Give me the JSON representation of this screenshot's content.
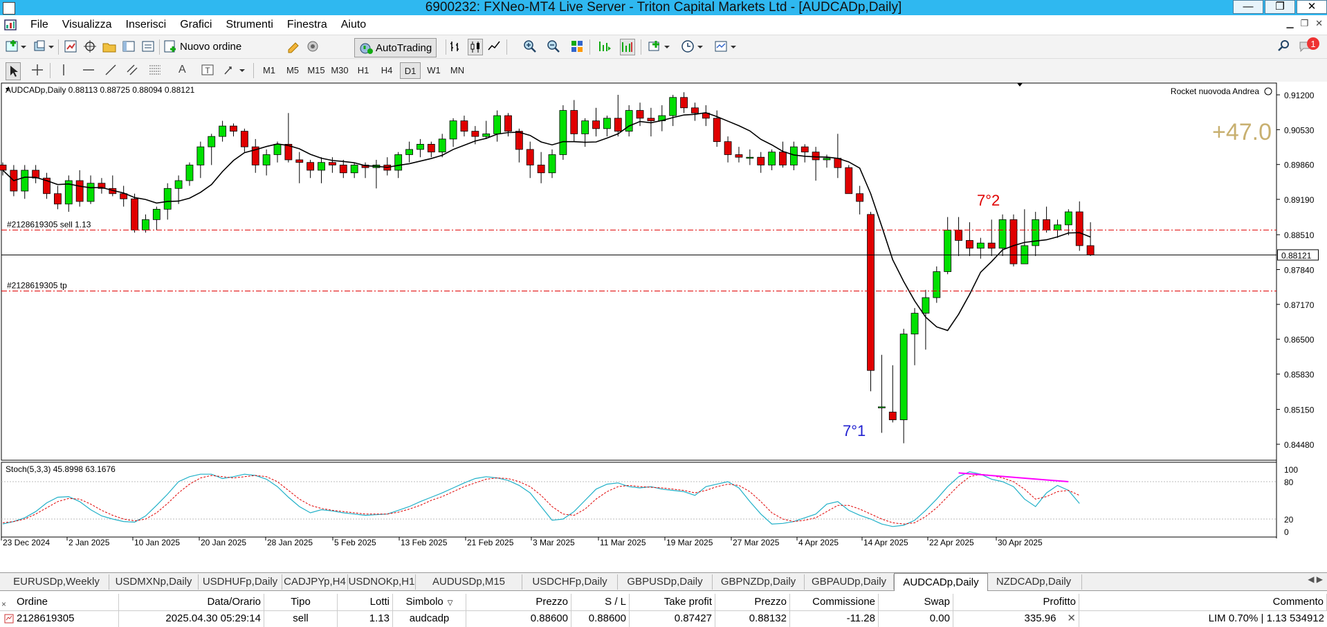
{
  "window": {
    "title": "6900232: FXNeo-MT4 Live Server - Triton Capital Markets Ltd - [AUDCADp,Daily]",
    "minimize": "—",
    "restore": "❐",
    "close": "✕"
  },
  "menu": {
    "items": [
      "File",
      "Visualizza",
      "Inserisci",
      "Grafici",
      "Strumenti",
      "Finestra",
      "Aiuto"
    ]
  },
  "toolbar": {
    "new_order_label": "Nuovo ordine",
    "autotrading_label": "AutoTrading",
    "timeframes": [
      "M1",
      "M5",
      "M15",
      "M30",
      "H1",
      "H4",
      "D1",
      "W1",
      "MN"
    ],
    "active_timeframe": "D1",
    "notification_count": "1"
  },
  "chart": {
    "header": "AUDCADp,Daily  0.88113 0.88725 0.88094 0.88121",
    "indicator_name": "Rocket nuovoda Andrea",
    "big_number": "+47.0",
    "current_price": "0.88121",
    "price_ticks": [
      "0.91200",
      "0.90530",
      "0.89860",
      "0.89190",
      "0.88510",
      "0.87840",
      "0.87170",
      "0.86500",
      "0.85830",
      "0.85150",
      "0.84480"
    ],
    "date_ticks": [
      "23 Dec 2024",
      "2 Jan 2025",
      "10 Jan 2025",
      "20 Jan 2025",
      "28 Jan 2025",
      "5 Feb 2025",
      "13 Feb 2025",
      "21 Feb 2025",
      "3 Mar 2025",
      "11 Mar 2025",
      "19 Mar 2025",
      "27 Mar 2025",
      "4 Apr 2025",
      "14 Apr 2025",
      "22 Apr 2025",
      "30 Apr 2025"
    ],
    "order_sell_label": "#2128619305 sell 1.13",
    "order_tp_label": "#2128619305 tp",
    "wave_label_top": "7°2",
    "wave_label_bottom": "7°1",
    "stoch_header": "Stoch(5,3,3) 45.8998 63.1676",
    "stoch_ticks": [
      "100",
      "80",
      "20",
      "0"
    ],
    "colors": {
      "bull": "#00e000",
      "bear": "#e00000",
      "ma": "#000000",
      "order_line": "#e00000",
      "stoch_main": "#20b0c8",
      "stoch_signal": "#e00000",
      "divergence": "#ff00ff"
    }
  },
  "chart_data": {
    "type": "candlestick",
    "ylim": [
      0.842,
      0.914
    ],
    "sell_price": 0.886,
    "tp_price": 0.87427,
    "candles": [
      [
        0.8985,
        0.899,
        0.8965,
        0.8975
      ],
      [
        0.8975,
        0.8985,
        0.8925,
        0.8935
      ],
      [
        0.8935,
        0.8985,
        0.892,
        0.8975
      ],
      [
        0.8975,
        0.8985,
        0.895,
        0.896
      ],
      [
        0.896,
        0.897,
        0.892,
        0.893
      ],
      [
        0.893,
        0.8945,
        0.89,
        0.891
      ],
      [
        0.891,
        0.8965,
        0.8895,
        0.8955
      ],
      [
        0.8955,
        0.8975,
        0.8905,
        0.8915
      ],
      [
        0.8915,
        0.8965,
        0.891,
        0.895
      ],
      [
        0.895,
        0.896,
        0.893,
        0.894
      ],
      [
        0.894,
        0.8965,
        0.8925,
        0.893
      ],
      [
        0.893,
        0.8945,
        0.8905,
        0.892
      ],
      [
        0.892,
        0.893,
        0.8855,
        0.886
      ],
      [
        0.886,
        0.889,
        0.8855,
        0.888
      ],
      [
        0.888,
        0.8905,
        0.886,
        0.89
      ],
      [
        0.89,
        0.895,
        0.888,
        0.894
      ],
      [
        0.894,
        0.8965,
        0.891,
        0.8955
      ],
      [
        0.8955,
        0.899,
        0.8945,
        0.8985
      ],
      [
        0.8985,
        0.903,
        0.896,
        0.902
      ],
      [
        0.902,
        0.9045,
        0.8985,
        0.904
      ],
      [
        0.904,
        0.907,
        0.903,
        0.906
      ],
      [
        0.906,
        0.9065,
        0.904,
        0.905
      ],
      [
        0.905,
        0.9055,
        0.901,
        0.902
      ],
      [
        0.902,
        0.9035,
        0.897,
        0.8985
      ],
      [
        0.8985,
        0.9015,
        0.8965,
        0.9005
      ],
      [
        0.9005,
        0.903,
        0.899,
        0.9025
      ],
      [
        0.9025,
        0.9085,
        0.899,
        0.8995
      ],
      [
        0.8995,
        0.901,
        0.895,
        0.899
      ],
      [
        0.899,
        0.8995,
        0.896,
        0.8975
      ],
      [
        0.8975,
        0.9,
        0.895,
        0.899
      ],
      [
        0.899,
        0.9,
        0.897,
        0.8985
      ],
      [
        0.8985,
        0.8995,
        0.896,
        0.897
      ],
      [
        0.897,
        0.899,
        0.896,
        0.8985
      ],
      [
        0.8985,
        0.899,
        0.896,
        0.898
      ],
      [
        0.898,
        0.8995,
        0.894,
        0.8985
      ],
      [
        0.8985,
        0.9,
        0.8965,
        0.8975
      ],
      [
        0.8975,
        0.901,
        0.896,
        0.9005
      ],
      [
        0.9005,
        0.903,
        0.899,
        0.9015
      ],
      [
        0.9015,
        0.9035,
        0.9,
        0.9025
      ],
      [
        0.9025,
        0.903,
        0.9,
        0.901
      ],
      [
        0.901,
        0.9045,
        0.9,
        0.9035
      ],
      [
        0.9035,
        0.9075,
        0.902,
        0.907
      ],
      [
        0.907,
        0.908,
        0.904,
        0.905
      ],
      [
        0.905,
        0.906,
        0.9025,
        0.904
      ],
      [
        0.904,
        0.907,
        0.9035,
        0.9045
      ],
      [
        0.9045,
        0.909,
        0.903,
        0.908
      ],
      [
        0.908,
        0.9085,
        0.904,
        0.905
      ],
      [
        0.905,
        0.9055,
        0.899,
        0.9015
      ],
      [
        0.9015,
        0.903,
        0.896,
        0.8985
      ],
      [
        0.8985,
        0.901,
        0.895,
        0.897
      ],
      [
        0.897,
        0.9015,
        0.896,
        0.9005
      ],
      [
        0.9005,
        0.91,
        0.8995,
        0.909
      ],
      [
        0.909,
        0.911,
        0.903,
        0.9045
      ],
      [
        0.9045,
        0.9075,
        0.902,
        0.907
      ],
      [
        0.907,
        0.9095,
        0.904,
        0.9055
      ],
      [
        0.9055,
        0.908,
        0.904,
        0.9075
      ],
      [
        0.9075,
        0.912,
        0.904,
        0.905
      ],
      [
        0.905,
        0.91,
        0.904,
        0.909
      ],
      [
        0.909,
        0.9105,
        0.906,
        0.9075
      ],
      [
        0.9075,
        0.9095,
        0.904,
        0.907
      ],
      [
        0.907,
        0.91,
        0.905,
        0.908
      ],
      [
        0.908,
        0.912,
        0.906,
        0.9115
      ],
      [
        0.9115,
        0.9125,
        0.9085,
        0.9095
      ],
      [
        0.9095,
        0.9105,
        0.907,
        0.9085
      ],
      [
        0.9085,
        0.91,
        0.906,
        0.9075
      ],
      [
        0.9075,
        0.909,
        0.902,
        0.903
      ],
      [
        0.903,
        0.904,
        0.899,
        0.9005
      ],
      [
        0.9005,
        0.902,
        0.899,
        0.9
      ],
      [
        0.9,
        0.9015,
        0.8985,
        0.9
      ],
      [
        0.9,
        0.901,
        0.897,
        0.8985
      ],
      [
        0.8985,
        0.9015,
        0.8975,
        0.901
      ],
      [
        0.901,
        0.903,
        0.898,
        0.8985
      ],
      [
        0.8985,
        0.903,
        0.8975,
        0.902
      ],
      [
        0.902,
        0.9025,
        0.899,
        0.901
      ],
      [
        0.901,
        0.902,
        0.8955,
        0.8995
      ],
      [
        0.8995,
        0.9005,
        0.898,
        0.8998
      ],
      [
        0.8998,
        0.9045,
        0.896,
        0.898
      ],
      [
        0.898,
        0.8985,
        0.895,
        0.893
      ],
      [
        0.893,
        0.8945,
        0.889,
        0.8915
      ],
      [
        0.889,
        0.8895,
        0.855,
        0.859
      ],
      [
        0.852,
        0.862,
        0.847,
        0.852
      ],
      [
        0.851,
        0.86,
        0.849,
        0.8495
      ],
      [
        0.8495,
        0.867,
        0.845,
        0.866
      ],
      [
        0.866,
        0.871,
        0.86,
        0.87
      ],
      [
        0.87,
        0.8745,
        0.863,
        0.873
      ],
      [
        0.873,
        0.879,
        0.872,
        0.878
      ],
      [
        0.878,
        0.8885,
        0.8775,
        0.886
      ],
      [
        0.886,
        0.8885,
        0.881,
        0.884
      ],
      [
        0.884,
        0.8875,
        0.881,
        0.8825
      ],
      [
        0.8825,
        0.8845,
        0.8805,
        0.8835
      ],
      [
        0.8835,
        0.888,
        0.881,
        0.8825
      ],
      [
        0.8825,
        0.889,
        0.881,
        0.888
      ],
      [
        0.888,
        0.889,
        0.879,
        0.8795
      ],
      [
        0.8795,
        0.89,
        0.8795,
        0.883
      ],
      [
        0.883,
        0.8895,
        0.881,
        0.888
      ],
      [
        0.888,
        0.8905,
        0.8855,
        0.886
      ],
      [
        0.886,
        0.888,
        0.8845,
        0.887
      ],
      [
        0.887,
        0.89,
        0.885,
        0.8895
      ],
      [
        0.8895,
        0.8915,
        0.882,
        0.883
      ],
      [
        0.883,
        0.8875,
        0.881,
        0.8812
      ]
    ],
    "stoch_main": [
      12,
      16,
      22,
      32,
      46,
      55,
      56,
      48,
      35,
      25,
      20,
      16,
      15,
      25,
      42,
      60,
      80,
      88,
      92,
      92,
      85,
      88,
      92,
      90,
      84,
      72,
      55,
      40,
      30,
      35,
      33,
      30,
      28,
      26,
      27,
      28,
      34,
      40,
      48,
      55,
      62,
      70,
      78,
      85,
      88,
      86,
      82,
      74,
      62,
      40,
      18,
      20,
      32,
      50,
      68,
      76,
      78,
      72,
      70,
      72,
      68,
      66,
      64,
      58,
      72,
      76,
      80,
      70,
      48,
      28,
      12,
      13,
      16,
      22,
      28,
      44,
      48,
      34,
      26,
      20,
      12,
      8,
      10,
      18,
      34,
      52,
      72,
      88,
      96,
      92,
      84,
      80,
      72,
      52,
      40,
      62,
      74,
      66,
      45
    ],
    "stoch_signal": [
      14,
      16,
      20,
      28,
      38,
      48,
      53,
      52,
      44,
      34,
      26,
      20,
      17,
      20,
      30,
      45,
      62,
      76,
      86,
      90,
      88,
      86,
      88,
      90,
      88,
      80,
      66,
      52,
      42,
      37,
      34,
      32,
      30,
      28,
      28,
      28,
      31,
      36,
      42,
      50,
      56,
      64,
      72,
      78,
      84,
      86,
      85,
      80,
      72,
      58,
      40,
      28,
      26,
      36,
      52,
      64,
      72,
      74,
      72,
      71,
      70,
      68,
      66,
      62,
      66,
      72,
      76,
      74,
      64,
      48,
      30,
      20,
      16,
      18,
      22,
      32,
      42,
      42,
      36,
      28,
      20,
      14,
      12,
      14,
      24,
      38,
      56,
      74,
      88,
      92,
      90,
      86,
      80,
      68,
      52,
      56,
      64,
      66,
      58
    ],
    "divergence": [
      [
        0.875,
        94
      ],
      [
        0.983,
        80
      ]
    ]
  },
  "tabs": [
    "EURUSDp,Weekly",
    "USDMXNp,Daily",
    "USDHUFp,Daily",
    "CADJPYp,H4",
    "USDNOKp,H1",
    "AUDUSDp,M15",
    "USDCHFp,Daily",
    "GBPUSDp,Daily",
    "GBPNZDp,Daily",
    "GBPAUDp,Daily",
    "AUDCADp,Daily",
    "NZDCADp,Daily"
  ],
  "active_tab": "AUDCADp,Daily",
  "orders": {
    "columns": [
      "Ordine",
      "Data/Orario",
      "Tipo",
      "Lotti",
      "Simbolo",
      "Prezzo",
      "S / L",
      "Take profit",
      "Prezzo",
      "Commissione",
      "Swap",
      "Profitto",
      "Commento"
    ],
    "sort_indicator": "▽",
    "row": {
      "order": "2128619305",
      "time": "2025.04.30 05:29:14",
      "type": "sell",
      "lots": "1.13",
      "symbol": "audcadp",
      "price": "0.88600",
      "sl": "0.88600",
      "tp": "0.87427",
      "current": "0.88132",
      "commission": "-11.28",
      "swap": "0.00",
      "profit": "335.96",
      "comment": "LIM 0.70% | 1.13 534912"
    }
  }
}
